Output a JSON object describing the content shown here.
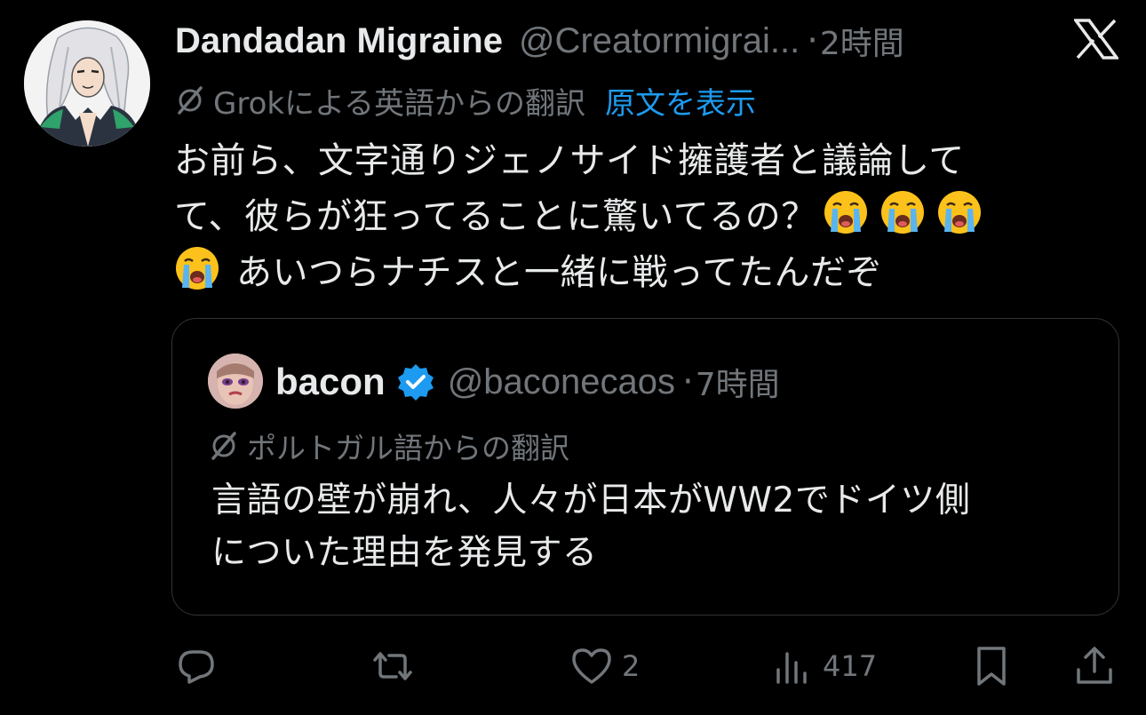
{
  "post": {
    "author": {
      "display_name": "Dandadan Migraine",
      "handle": "@Creatormigrai...",
      "avatar": "anime-character-avatar"
    },
    "separator": "·",
    "time": "2時間",
    "platform_logo": "x-logo-icon",
    "translation": {
      "label": "Grokによる英語からの翻訳",
      "show_original": "原文を表示"
    },
    "text_lines": [
      "お前ら、文字通りジェノサイド擁護者と議論して",
      "て、彼らが狂ってることに驚いてるの？",
      "あいつらナチスと一緒に戦ってたんだぞ"
    ],
    "emoji": "loudly-crying-face-emoji"
  },
  "quote": {
    "author": {
      "display_name": "bacon",
      "handle": "@baconecaos",
      "verified": true,
      "avatar": "photo-avatar"
    },
    "separator": "·",
    "time": "7時間",
    "translation": {
      "label": "ポルトガル語からの翻訳"
    },
    "text_lines": [
      "言語の壁が崩れ、人々が日本がWW2でドイツ側",
      "についた理由を発見する"
    ]
  },
  "actions": {
    "reply": {
      "icon": "reply-icon",
      "count": ""
    },
    "repost": {
      "icon": "repost-icon",
      "count": ""
    },
    "like": {
      "icon": "heart-icon",
      "count": "2"
    },
    "views": {
      "icon": "views-chart-icon",
      "count": "417"
    },
    "bookmark": {
      "icon": "bookmark-icon"
    },
    "share": {
      "icon": "share-icon"
    }
  },
  "colors": {
    "background": "#000000",
    "text_primary": "#e7e9ea",
    "text_secondary": "#71767b",
    "link": "#1d9bf0",
    "border": "#2f3336",
    "verified": "#1d9bf0"
  }
}
